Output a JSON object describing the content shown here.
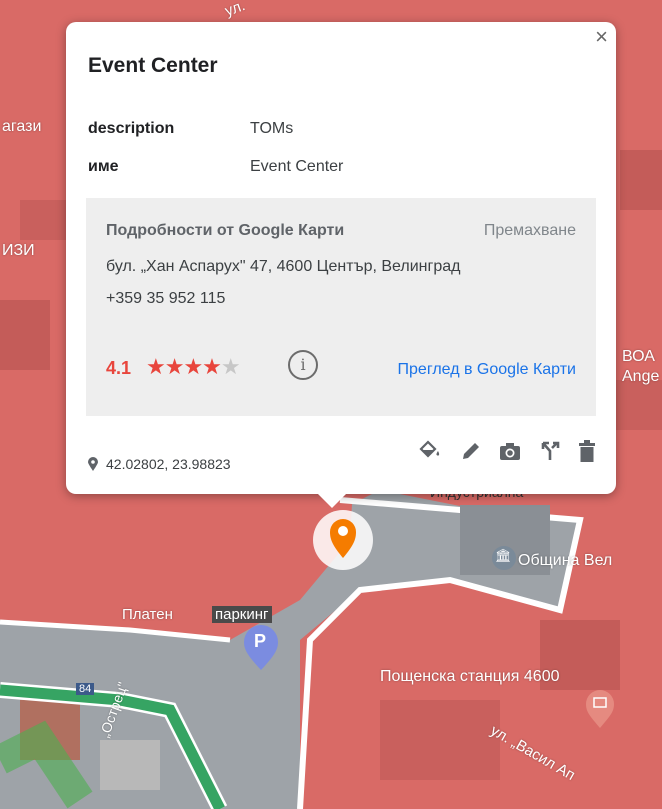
{
  "popup": {
    "title": "Event Center",
    "close_glyph": "×",
    "fields": [
      {
        "key": "description",
        "value": "TOMs"
      },
      {
        "key": "име",
        "value": "Event Center"
      }
    ],
    "google": {
      "title": "Подробности от Google Карти",
      "remove": "Премахване",
      "address": "бул. „Хан Аспарух\" 47, 4600 Център, Велинград",
      "phone": "+359 35 952 115",
      "rating": "4.1",
      "stars_filled": "★★★★",
      "stars_empty": "★",
      "info_glyph": "i",
      "view_link": "Преглед в Google Карти"
    },
    "coords": "42.02802, 23.98823",
    "tools": [
      "paint-bucket-icon",
      "pencil-icon",
      "camera-icon",
      "directions-icon",
      "trash-icon"
    ]
  },
  "map": {
    "labels": {
      "street_top": "ул.",
      "left_fragment_1": "агази",
      "left_fragment_2": "ИЗИ",
      "right_fragment_1": "ВОА",
      "right_fragment_2": "Ange",
      "parking_left": "Платен",
      "parking_right": "паркинг",
      "parking_badge": "P",
      "municipality": "Община Вел",
      "municipality_badge": "🏛",
      "post_office": "Пощенска станция 4600",
      "street_vasil": "ул. „Васил Ап",
      "street_ostrets": "„Острец\"",
      "road_number": "84",
      "street_bottom_top": "Индустриална"
    },
    "colors": {
      "overlay_red": "#d96a66",
      "pin_orange": "#f57c00",
      "green_road": "#36a463",
      "link_blue": "#1a73e8",
      "rating_red": "#e8453c"
    }
  }
}
